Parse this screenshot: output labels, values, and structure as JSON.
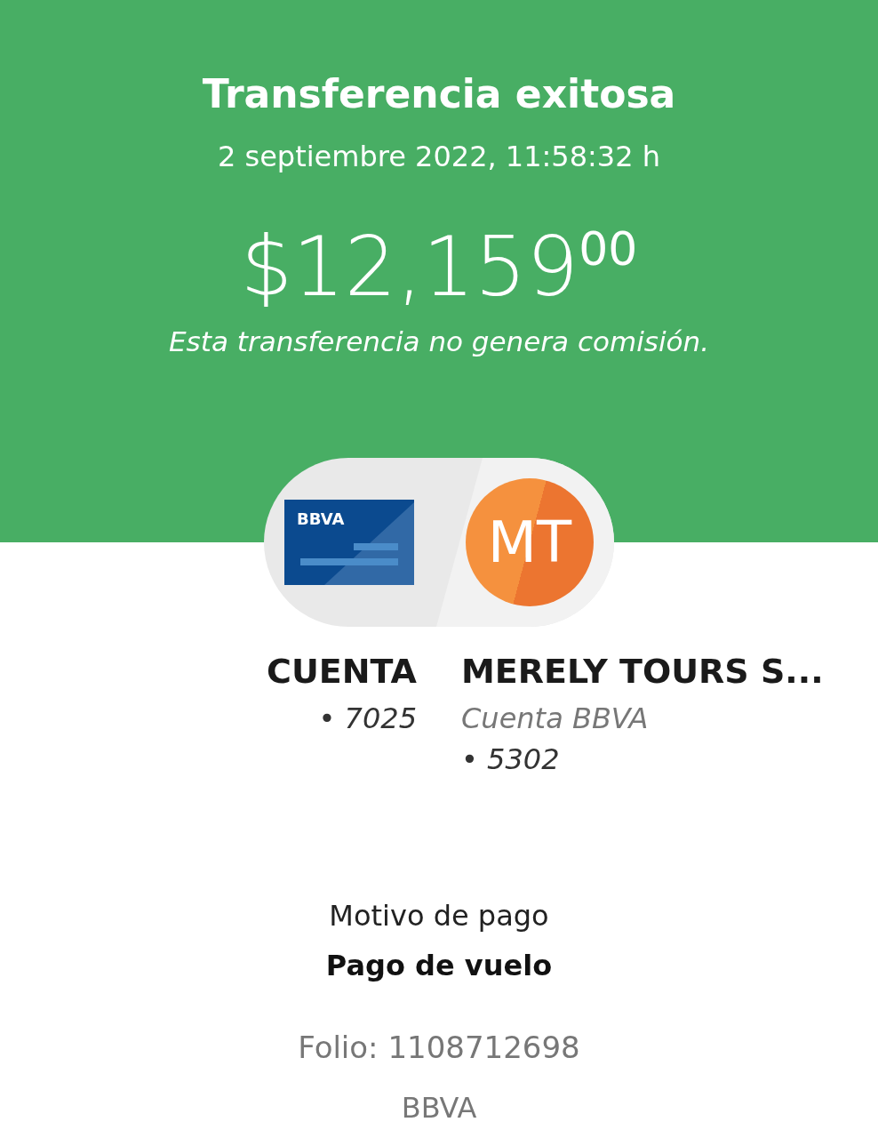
{
  "header": {
    "title": "Transferencia exitosa",
    "date": "2 septiembre 2022, 11:58:32 h",
    "amount": "$12,159",
    "cents": "00",
    "note": "Esta transferencia no genera comisión."
  },
  "origin": {
    "card_logo": "BBVA",
    "name": "CUENTA",
    "lines": [
      "• 7025"
    ]
  },
  "destination": {
    "initials": "MT",
    "name": "MERELY TOURS S...",
    "lines": [
      "Cuenta BBVA",
      "• 5302"
    ]
  },
  "details": {
    "label": "Motivo de pago",
    "value": "Pago de vuelo",
    "folio": "Folio: 1108712698",
    "bank": "BBVA"
  }
}
